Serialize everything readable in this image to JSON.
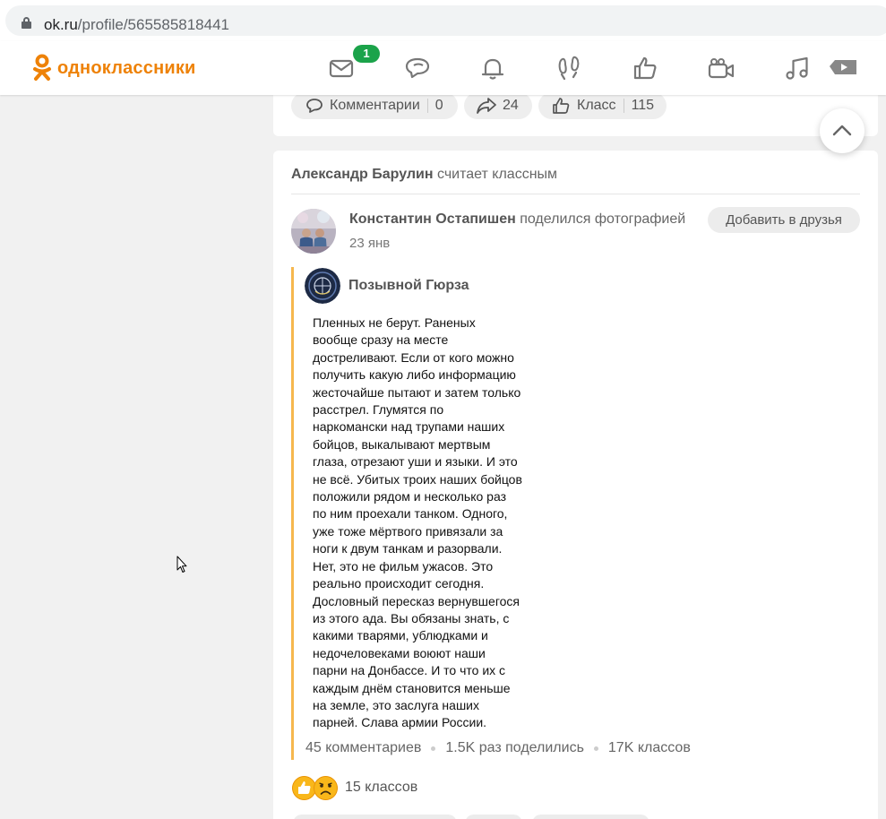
{
  "browser": {
    "url_domain": "ok.ru",
    "url_path": "/profile/565585818441"
  },
  "header": {
    "logo_text": "одноклассники",
    "messages_badge": "1",
    "nav_icons": [
      "mail-icon",
      "discussions-icon",
      "notifications-icon",
      "guests-icon",
      "likes-icon",
      "video-camera-icon",
      "music-icon",
      "video-play-icon"
    ]
  },
  "prev_post": {
    "comments_label": "Комментарии",
    "comments_count": "0",
    "shares_count": "24",
    "class_label": "Класс",
    "class_count": "115"
  },
  "feed_item": {
    "actor_name": "Александр Барулин",
    "actor_action": "считает классным",
    "author_name": "Константин Остапишен",
    "author_action": "поделился фотографией",
    "add_friend_label": "Добавить в друзья",
    "date": "23 янв",
    "group_name": "Позывной Гюрза",
    "post_lines": [
      "Пленных не берут. Раненых",
      "вообще сразу на месте",
      "достреливают. Если от кого можно",
      "получить какую либо информацию",
      "жесточайше пытают и затем только",
      "расстрел. Глумятся по",
      "наркомански над трупами наших",
      "бойцов, выкалывают мертвым",
      "глаза, отрезают уши и языки. И это",
      "не всё. Убитых троих наших бойцов",
      "положили рядом и несколько раз",
      "по ним проехали танком. Одного,",
      "уже тоже мёртвого привязали за",
      "ноги к двум танкам и разорвали.",
      "Нет, это не фильм ужасов. Это",
      "реально происходит сегодня.",
      "Дословный пересказ вернувшегося",
      "из этого ада. Вы  обязаны знать, с",
      "какими тварями, ублюдками и",
      "недочеловеками воюют наши",
      "парни на Донбассе. И то что их с",
      "каждым днём становится меньше",
      "на земле, это заслуга наших",
      "парней. Слава армии России."
    ],
    "stats": {
      "comments": "45 комментариев",
      "shares": "1.5K раз поделились",
      "classes": "17K классов"
    },
    "reactions_label": "15 классов"
  },
  "colors": {
    "brand_orange": "#ee8208",
    "badge_green": "#1ba34a",
    "repost_bar": "#f6b74e"
  }
}
